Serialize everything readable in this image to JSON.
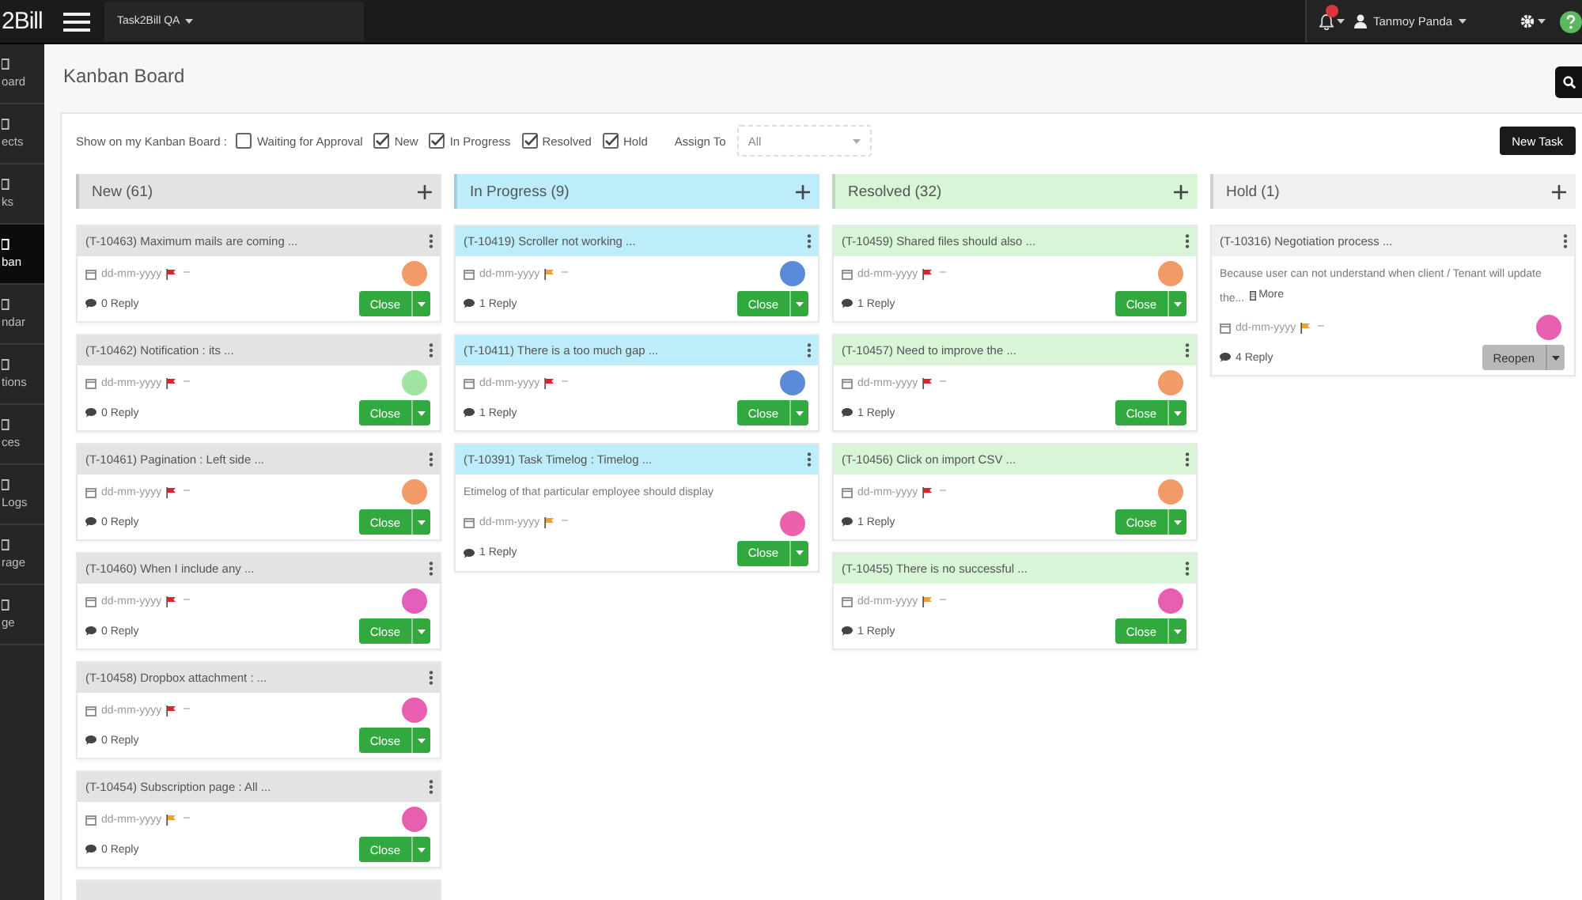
{
  "top_bar": {
    "logo": "2Bill",
    "project": "Task2Bill QA",
    "user": "Tanmoy Panda"
  },
  "sidebar": {
    "items": [
      {
        "label": "oard",
        "selected": false
      },
      {
        "label": "ects",
        "selected": false
      },
      {
        "label": "ks",
        "selected": false
      },
      {
        "label": "ban",
        "selected": true
      },
      {
        "label": "ndar",
        "selected": false
      },
      {
        "label": "tions",
        "selected": false
      },
      {
        "label": "ces",
        "selected": false
      },
      {
        "label": "Logs",
        "selected": false
      },
      {
        "label": "rage",
        "selected": false
      },
      {
        "label": "ge",
        "selected": false
      }
    ]
  },
  "page_title": "Kanban Board",
  "filters": {
    "label": "Show on my Kanban Board :",
    "options": [
      {
        "label": "Waiting for Approval",
        "checked": false
      },
      {
        "label": "New",
        "checked": true
      },
      {
        "label": "In Progress",
        "checked": true
      },
      {
        "label": "Resolved",
        "checked": true
      },
      {
        "label": "Hold",
        "checked": true
      }
    ],
    "assign_label": "Assign To",
    "assign_value": "All"
  },
  "new_task_button": "New Task",
  "columns": [
    {
      "title": "New (61)",
      "color": "#e3e3e3",
      "cut_card": true,
      "cards": [
        {
          "title": "(T-10463) Maximum mails are coming ...",
          "date": "dd-mm-yyyy",
          "flag": {
            "color": "#d8262b"
          },
          "avatar": {
            "color": "#f29a68"
          },
          "replies": "0 Reply",
          "button": {
            "label": "Close",
            "kind": "close"
          }
        },
        {
          "title": "(T-10462) Notification : its ...",
          "date": "dd-mm-yyyy",
          "flag": {
            "color": "#d8262b"
          },
          "avatar": {
            "color": "#9fe59f"
          },
          "replies": "0 Reply",
          "button": {
            "label": "Close",
            "kind": "close"
          }
        },
        {
          "title": "(T-10461) Pagination : Left side ...",
          "date": "dd-mm-yyyy",
          "flag": {
            "color": "#d8262b"
          },
          "avatar": {
            "color": "#f29a68"
          },
          "replies": "0 Reply",
          "button": {
            "label": "Close",
            "kind": "close"
          }
        },
        {
          "title": "(T-10460) When I include any ...",
          "date": "dd-mm-yyyy",
          "flag": {
            "color": "#d8262b"
          },
          "avatar": {
            "color": "#e35fbb"
          },
          "replies": "0 Reply",
          "button": {
            "label": "Close",
            "kind": "close"
          }
        },
        {
          "title": "(T-10458) Dropbox attachment : ...",
          "date": "dd-mm-yyyy",
          "flag": {
            "color": "#d8262b"
          },
          "avatar": {
            "color": "#e95fb0"
          },
          "replies": "0 Reply",
          "button": {
            "label": "Close",
            "kind": "close"
          }
        },
        {
          "title": "(T-10454) Subscription page : All ...",
          "date": "dd-mm-yyyy",
          "flag": {
            "color": "#f0a030"
          },
          "avatar": {
            "color": "#e95fb0"
          },
          "replies": "0 Reply",
          "button": {
            "label": "Close",
            "kind": "close"
          }
        }
      ]
    },
    {
      "title": "In Progress (9)",
      "color": "#bdedfa",
      "cut_card": false,
      "cards": [
        {
          "title": "(T-10419) Scroller not working ...",
          "date": "dd-mm-yyyy",
          "flag": {
            "color": "#f0a030"
          },
          "avatar": {
            "color": "#5b8bd8"
          },
          "replies": "1 Reply",
          "button": {
            "label": "Close",
            "kind": "close"
          }
        },
        {
          "title": "(T-10411) There is a too much gap ...",
          "date": "dd-mm-yyyy",
          "flag": {
            "color": "#d8262b"
          },
          "avatar": {
            "color": "#5b8bd8"
          },
          "replies": "1 Reply",
          "button": {
            "label": "Close",
            "kind": "close"
          }
        },
        {
          "title": "(T-10391) Task Timelog : Timelog ...",
          "description": "Etimelog of that particular employee should display",
          "date": "dd-mm-yyyy",
          "flag": {
            "color": "#f0a030"
          },
          "avatar": {
            "color": "#ee5fae"
          },
          "replies": "1 Reply",
          "button": {
            "label": "Close",
            "kind": "close"
          }
        }
      ]
    },
    {
      "title": "Resolved (32)",
      "color": "#d8f5d8",
      "cut_card": false,
      "cards": [
        {
          "title": "(T-10459) Shared files should also ...",
          "date": "dd-mm-yyyy",
          "flag": {
            "color": "#d8262b"
          },
          "avatar": {
            "color": "#f29a68"
          },
          "replies": "1 Reply",
          "button": {
            "label": "Close",
            "kind": "close"
          }
        },
        {
          "title": "(T-10457) Need to improve the ...",
          "date": "dd-mm-yyyy",
          "flag": {
            "color": "#d8262b"
          },
          "avatar": {
            "color": "#f29a68"
          },
          "replies": "1 Reply",
          "button": {
            "label": "Close",
            "kind": "close"
          }
        },
        {
          "title": "(T-10456) Click on import CSV ...",
          "date": "dd-mm-yyyy",
          "flag": {
            "color": "#d8262b"
          },
          "avatar": {
            "color": "#f29a68"
          },
          "replies": "1 Reply",
          "button": {
            "label": "Close",
            "kind": "close"
          }
        },
        {
          "title": "(T-10455) There is no successful ...",
          "date": "dd-mm-yyyy",
          "flag": {
            "color": "#f0a030"
          },
          "avatar": {
            "color": "#e95fb0"
          },
          "replies": "1 Reply",
          "button": {
            "label": "Close",
            "kind": "close"
          }
        }
      ]
    },
    {
      "title": "Hold (1)",
      "color": "#f0f0f0",
      "cut_card": false,
      "cards": [
        {
          "title": "(T-10316) Negotiation process ...",
          "description": "Because user can not understand when client / Tenant will update the...",
          "more": "More",
          "date": "dd-mm-yyyy",
          "flag": {
            "color": "#f0a030"
          },
          "avatar": {
            "color": "#e95fb0"
          },
          "replies": "4 Reply",
          "button": {
            "label": "Reopen",
            "kind": "reopen"
          }
        }
      ]
    }
  ]
}
